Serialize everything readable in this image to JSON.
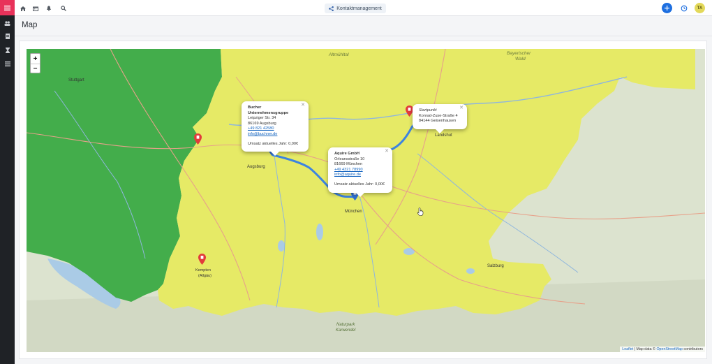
{
  "app": {
    "module_label": "Kontaktmanagement",
    "avatar_initials": "TA"
  },
  "page": {
    "title": "Map"
  },
  "colors": {
    "brand": "#e8325a",
    "sidebar_bg": "#1f2226",
    "accent_blue": "#1e6fe0",
    "route": "#3d84e0",
    "region_green": "#3fae49",
    "region_yellow": "#e7ea66",
    "marker_red": "#e23b3b"
  },
  "icons": {
    "sidebar": [
      "menu-icon",
      "contacts-icon",
      "documents-icon",
      "hourglass-icon",
      "list-icon"
    ],
    "topbar": [
      "home-icon",
      "calendar-icon",
      "bell-icon",
      "search-icon",
      "share-icon",
      "plus-icon",
      "timer-icon"
    ]
  },
  "map": {
    "zoom_in": "+",
    "zoom_out": "−",
    "popups": [
      {
        "name": "Bucher Unternehmensgruppe",
        "street": "Leipziger Str. 34",
        "city": "86169 Augsburg",
        "phone": "+49 821 42580",
        "email": "info@buchner.de",
        "revenue": "Umsatz aktuelles Jahr: 0,00€"
      },
      {
        "name": "Aquire GmbH",
        "street": "Orleansstraße 10",
        "city": "81669 München",
        "phone": "+49 4321 78990",
        "email": "info@aquire.de",
        "revenue": "Umsatz aktuelles Jahr: 0,00€"
      },
      {
        "label": "Startpunkt",
        "street": "Konrad-Zuse-Straße 4",
        "city": "84144 Geisenhausen"
      }
    ],
    "place_labels": [
      "Altmühltal",
      "Bayerischer Wald",
      "Stuttgart",
      "Augsburg",
      "München",
      "Kempten (Allgäu)",
      "Salzburg",
      "Naturpark Karwendel",
      "Landshut"
    ],
    "attribution": {
      "leaflet": "Leaflet",
      "separator": " | Map data © ",
      "osm": "OpenStreetMap",
      "suffix": " contributors"
    }
  }
}
